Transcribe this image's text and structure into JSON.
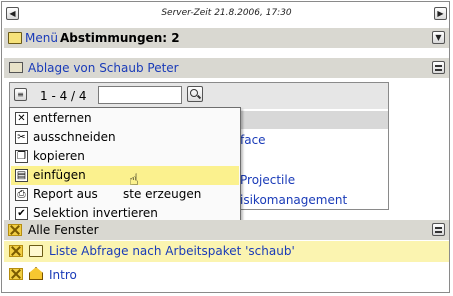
{
  "server_time": "Server-Zeit 21.8.2006, 17:30",
  "header_menu": {
    "menu_label": "Menü",
    "title": "Abstimmungen: 2"
  },
  "ablage": {
    "title": "Ablage von Schaub Peter",
    "count": "1 - 4 / 4",
    "search_value": "",
    "rows": [
      "face",
      "",
      "Projectile",
      "isikomanagement"
    ]
  },
  "context_menu": {
    "items": [
      {
        "label": "entfernen",
        "icon": "remove-icon"
      },
      {
        "label": "ausschneiden",
        "icon": "scissors-icon"
      },
      {
        "label": "kopieren",
        "icon": "copy-icon"
      },
      {
        "label": "einfügen",
        "icon": "paste-icon"
      },
      {
        "label": "Report aus",
        "label2": "ste erzeugen",
        "icon": "report-icon"
      },
      {
        "label": "Selektion invertieren",
        "icon": "checkbox-icon"
      }
    ],
    "highlight_index": 3
  },
  "all_windows": {
    "title": "Alle Fenster",
    "items": [
      {
        "label": "Liste Abfrage nach Arbeitspaket 'schaub'",
        "icon": "folder-icon"
      },
      {
        "label": "Intro",
        "icon": "home-icon"
      }
    ]
  },
  "colors": {
    "header_bg": "#d9d8d1",
    "highlight": "#fbf18e",
    "link": "#1a3bb8"
  }
}
